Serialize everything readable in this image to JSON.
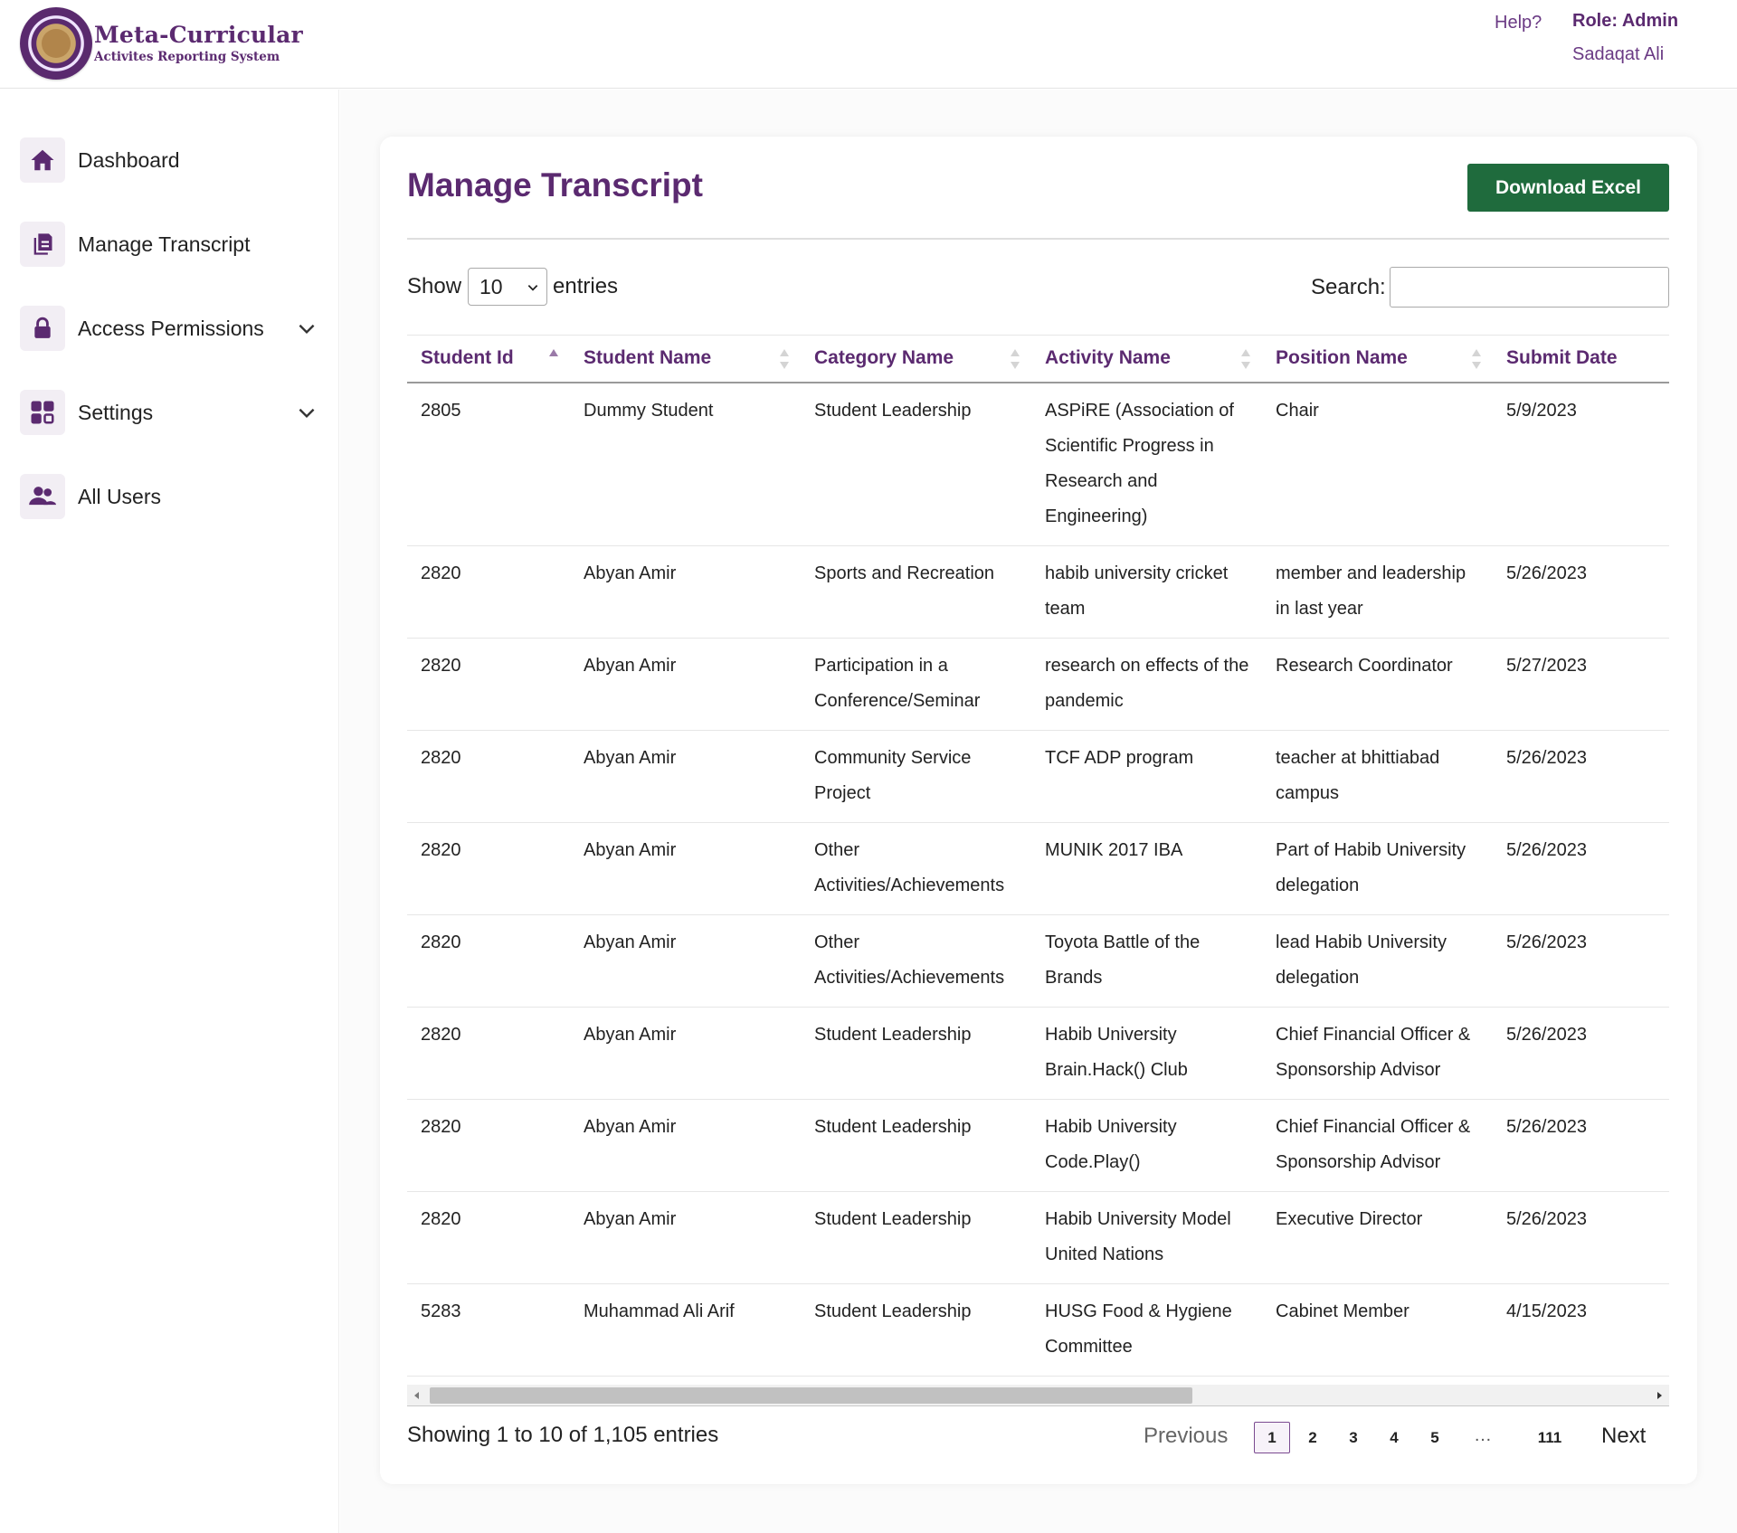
{
  "brand": {
    "title": "Meta-Curricular",
    "subtitle": "Activites Reporting System",
    "seal_text": "HABIB UNIVERSITY"
  },
  "header": {
    "help": "Help?",
    "role": "Role: Admin",
    "user": "Sadaqat Ali"
  },
  "sidebar": {
    "items": [
      {
        "label": "Dashboard",
        "icon": "home-icon"
      },
      {
        "label": "Manage Transcript",
        "icon": "document-icon"
      },
      {
        "label": "Access Permissions",
        "icon": "lock-icon",
        "expandable": true
      },
      {
        "label": "Settings",
        "icon": "grid-icon",
        "expandable": true
      },
      {
        "label": "All Users",
        "icon": "users-icon"
      }
    ]
  },
  "page": {
    "title": "Manage Transcript",
    "download_label": "Download Excel"
  },
  "controls": {
    "show_label": "Show",
    "page_size": "10",
    "entries_label": "entries",
    "search_label": "Search:",
    "search_value": ""
  },
  "table": {
    "columns": [
      "Student Id",
      "Student Name",
      "Category Name",
      "Activity Name",
      "Position Name",
      "Submit Date"
    ],
    "rows": [
      [
        "2805",
        "Dummy Student",
        "Student Leadership",
        "ASPiRE (Association of Scientific Progress in Research and Engineering)",
        "Chair",
        "5/9/2023"
      ],
      [
        "2820",
        "Abyan Amir",
        "Sports and Recreation",
        "habib university cricket team",
        "member and leadership in last year",
        "5/26/2023"
      ],
      [
        "2820",
        "Abyan Amir",
        "Participation in a Conference/Seminar",
        "research on effects of the pandemic",
        "Research Coordinator",
        "5/27/2023"
      ],
      [
        "2820",
        "Abyan Amir",
        "Community Service Project",
        "TCF ADP program",
        "teacher at bhittiabad campus",
        "5/26/2023"
      ],
      [
        "2820",
        "Abyan Amir",
        "Other Activities/Achievements",
        "MUNIK 2017 IBA",
        "Part of Habib University delegation",
        "5/26/2023"
      ],
      [
        "2820",
        "Abyan Amir",
        "Other Activities/Achievements",
        "Toyota Battle of the Brands",
        "lead Habib University delegation",
        "5/26/2023"
      ],
      [
        "2820",
        "Abyan Amir",
        "Student Leadership",
        "Habib University Brain.Hack() Club",
        "Chief Financial Officer & Sponsorship Advisor",
        "5/26/2023"
      ],
      [
        "2820",
        "Abyan Amir",
        "Student Leadership",
        "Habib University Code.Play()",
        "Chief Financial Officer & Sponsorship Advisor",
        "5/26/2023"
      ],
      [
        "2820",
        "Abyan Amir",
        "Student Leadership",
        "Habib University Model United Nations",
        "Executive Director",
        "5/26/2023"
      ],
      [
        "5283",
        "Muhammad Ali Arif",
        "Student Leadership",
        "HUSG Food & Hygiene Committee",
        "Cabinet Member",
        "4/15/2023"
      ]
    ]
  },
  "footer": {
    "info": "Showing 1 to 10 of 1,105 entries",
    "previous": "Previous",
    "pages": [
      "1",
      "2",
      "3",
      "4",
      "5"
    ],
    "ellipsis": "…",
    "last_page": "111",
    "next": "Next",
    "active_page": "1"
  },
  "colors": {
    "brand_purple": "#5b2a70",
    "excel_green": "#1f6b3d"
  }
}
